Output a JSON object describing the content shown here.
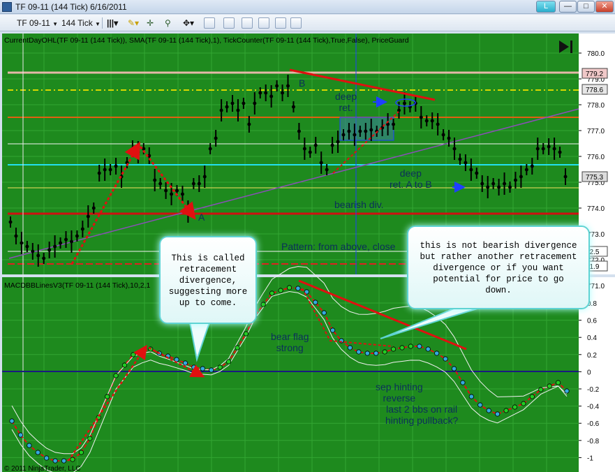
{
  "window": {
    "title": "TF 09-11 (144 Tick)  6/16/2011",
    "buttons": {
      "help": "L",
      "minimize": "—",
      "maximize": "□",
      "close": "✕"
    }
  },
  "toolbar": {
    "instrument": "TF 09-11",
    "period": "144 Tick",
    "icons": [
      "bar-style-icon",
      "pencil-icon",
      "crosshair-icon",
      "magnifier-icon",
      "properties-icon",
      "zoom-icon",
      "chart-trader-icon",
      "snapshot-icon",
      "data-box-icon"
    ]
  },
  "price_panel": {
    "indicator_label": "CurrentDayOHL(TF 09-11 (144 Tick)), SMA(TF 09-11 (144 Tick),1), TickCounter(TF 09-11 (144 Tick),True,False), PriceGuard",
    "axis_ticks": [
      "780.0",
      "779.0",
      "778.0",
      "777.0",
      "776.0",
      "775.0",
      "774.0",
      "773.0",
      "772.0",
      "771.0"
    ],
    "price_flags": [
      {
        "value": "779.2",
        "color": "#f0c8c8"
      },
      {
        "value": "778.6",
        "color": "#e6e6e6"
      },
      {
        "value": "775.3",
        "color": "#dcdcdc"
      },
      {
        "value": "72.5",
        "color": "#ffffff"
      },
      {
        "value": "71.9",
        "color": "#ffffff"
      }
    ],
    "annotations": {
      "b_label": "B",
      "a_label": "A",
      "deep_ret_1": "deep\nret.",
      "deep_ret_2": "deep\nret. A to B",
      "bearish_div": "bearish div.",
      "pattern": "Pattern: from above, close"
    }
  },
  "macd_panel": {
    "indicator_label": "MACDBBLinesV3(TF 09-11 (144 Tick),10,2,1",
    "axis_ticks": [
      "0.8",
      "0.6",
      "0.4",
      "0.2",
      "0",
      "-0.2",
      "-0.4",
      "-0.6",
      "-0.8",
      "-1"
    ],
    "annotations": {
      "bear_flag": "bear flag\nstrong",
      "sep_hint": "sep hinting\nreverse",
      "last_bbs": "last 2 bbs on rail\nhinting pullback?"
    }
  },
  "callouts": {
    "retracement": "This is called\nretracement\ndivergence,\nsuggesting more\nup to come.",
    "not_bearish": "this is not bearish divergence\nbut rather another retracement\ndivergence or if you want\npotential for price to go\ndown."
  },
  "copyright": "© 2011 NinjaTrader, LLC",
  "colors": {
    "chart_bg": "#1e8a1e",
    "grid": "#2fa02f",
    "trend_red": "#e01010",
    "callout_border": "#5fd3d3",
    "dot_up": "#22cc22",
    "dot_down": "#33aadd"
  }
}
